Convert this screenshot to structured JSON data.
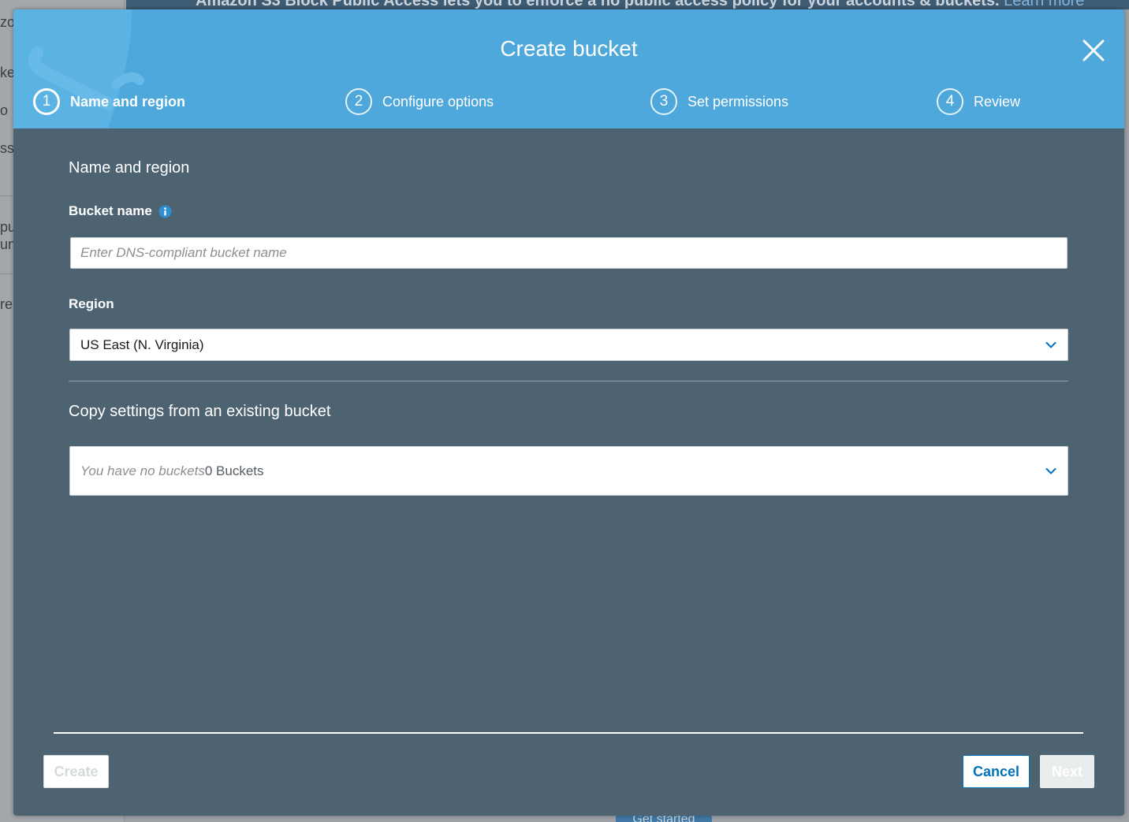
{
  "background": {
    "sidebar_fragments": [
      "zo",
      "ke",
      "o",
      "ss",
      "pu",
      "un",
      "re"
    ],
    "banner_text": "Amazon S3 Block Public Access lets you to enforce a no public access policy for your accounts & buckets.",
    "banner_link": "Learn more",
    "get_started": "Get started"
  },
  "modal": {
    "title": "Create bucket",
    "steps": [
      {
        "number": "1",
        "label": "Name and region",
        "active": true
      },
      {
        "number": "2",
        "label": "Configure options",
        "active": false
      },
      {
        "number": "3",
        "label": "Set permissions",
        "active": false
      },
      {
        "number": "4",
        "label": "Review",
        "active": false
      }
    ],
    "section_title": "Name and region",
    "bucket_name": {
      "label": "Bucket name",
      "placeholder": "Enter DNS-compliant bucket name",
      "value": ""
    },
    "region": {
      "label": "Region",
      "selected": "US East (N. Virginia)"
    },
    "copy_settings": {
      "title": "Copy settings from an existing bucket",
      "placeholder": "You have no buckets",
      "count": "0 Buckets"
    },
    "buttons": {
      "create": "Create",
      "cancel": "Cancel",
      "next": "Next"
    }
  },
  "colors": {
    "header": "#4ea8dc",
    "body": "#4e6372",
    "accent": "#0073bb",
    "chevron": "#0073bb"
  }
}
